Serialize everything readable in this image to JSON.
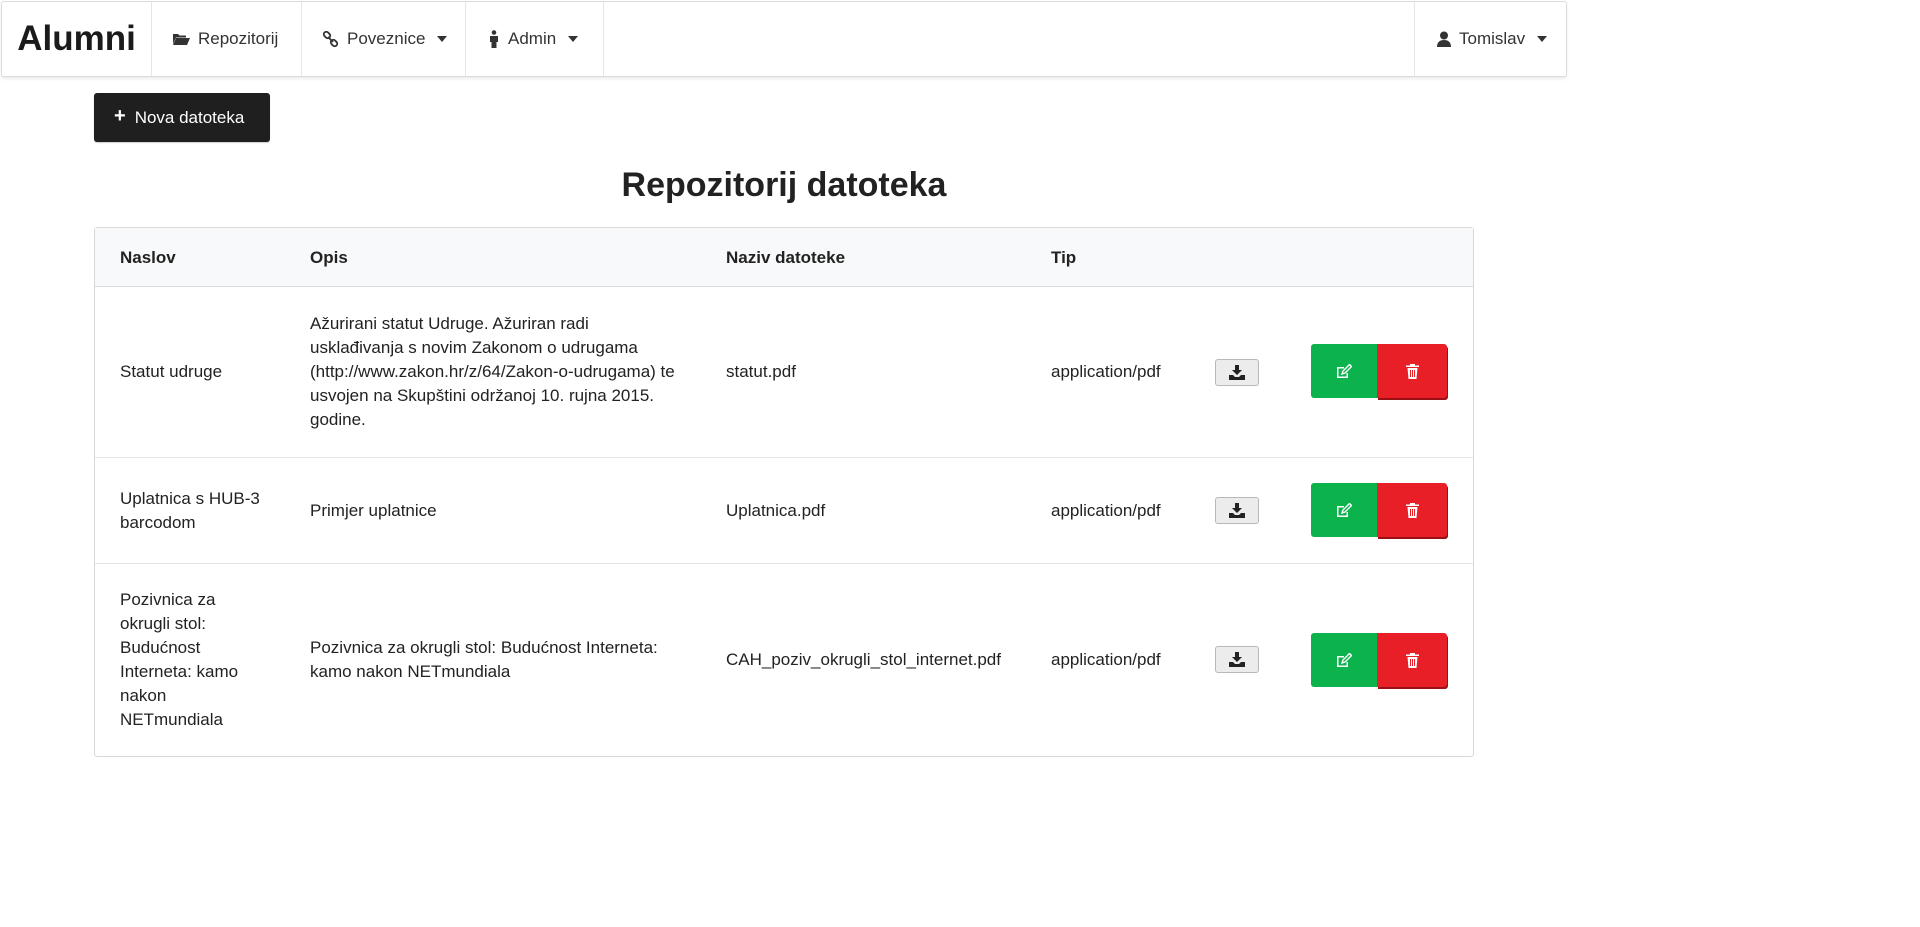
{
  "nav": {
    "brand": "Alumni",
    "items": [
      {
        "label": "Repozitorij",
        "icon": "folder-open-icon"
      },
      {
        "label": "Poveznice",
        "icon": "link-icon"
      },
      {
        "label": "Admin",
        "icon": "person-icon"
      }
    ],
    "user": {
      "label": "Tomislav",
      "icon": "user-icon"
    }
  },
  "toolbar": {
    "new_label": "Nova datoteka"
  },
  "page": {
    "title": "Repozitorij datoteka"
  },
  "table": {
    "headers": [
      "Naslov",
      "Opis",
      "Naziv datoteke",
      "Tip"
    ],
    "rows": [
      {
        "naslov": "Statut udruge",
        "opis": "Ažurirani statut Udruge. Ažuriran radi usklađivanja s novim Zakonom o udrugama (http://www.zakon.hr/z/64/Zakon-o-udrugama) te usvojen na Skupštini održanoj 10. rujna 2015. godine.",
        "naziv": "statut.pdf",
        "tip": "application/pdf"
      },
      {
        "naslov": "Uplatnica s HUB-3 barcodom",
        "opis": "Primjer uplatnice",
        "naziv": "Uplatnica.pdf",
        "tip": "application/pdf"
      },
      {
        "naslov": "Pozivnica za okrugli stol: Budućnost Interneta: kamo nakon NETmundiala",
        "opis": "Pozivnica za okrugli stol: Budućnost Interneta: kamo nakon NETmundiala",
        "naziv": "CAH_poziv_okrugli_stol_internet.pdf",
        "tip": "application/pdf"
      }
    ]
  },
  "colors": {
    "edit": "#0cb24c",
    "delete": "#e81f26",
    "dark_button": "#1f1f1f"
  }
}
